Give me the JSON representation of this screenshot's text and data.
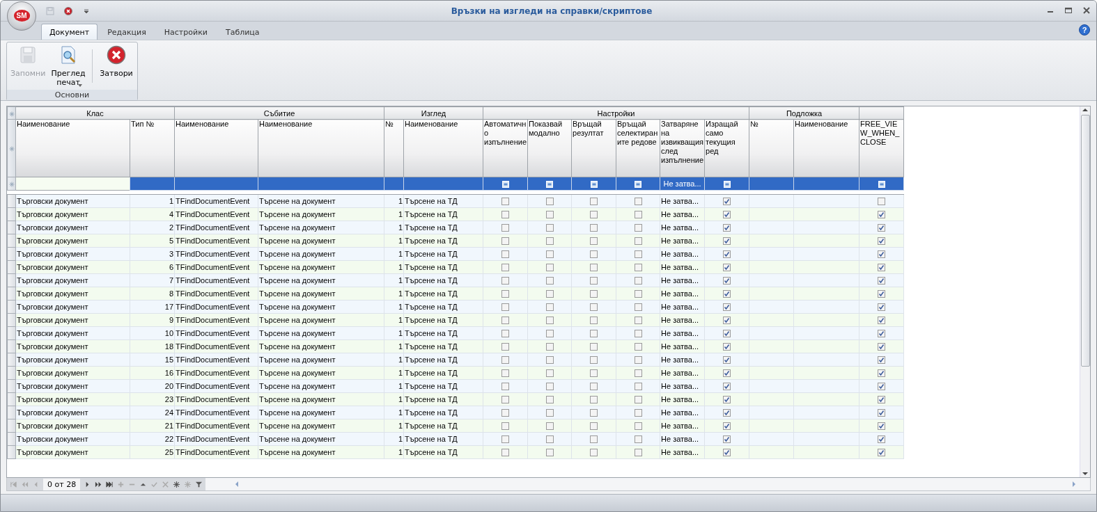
{
  "window": {
    "title": "Връзки на изгледи на справки/скриптове",
    "logo": "SM",
    "help": "?"
  },
  "ribbon_tabs": [
    {
      "label": "Документ",
      "selected": true
    },
    {
      "label": "Редакция",
      "selected": false
    },
    {
      "label": "Настройки",
      "selected": false
    },
    {
      "label": "Таблица",
      "selected": false
    }
  ],
  "ribbon_group": {
    "label": "Основни",
    "buttons": [
      {
        "kind": "save",
        "label": "Запомни",
        "disabled": true,
        "dropdown": false
      },
      {
        "kind": "preview",
        "label": "Преглед печат",
        "disabled": false,
        "dropdown": true
      },
      {
        "kind": "close",
        "label": "Затвори",
        "disabled": false,
        "dropdown": false
      }
    ]
  },
  "grid": {
    "bands": [
      {
        "label": "Клас"
      },
      {
        "label": "Събитие"
      },
      {
        "label": "Изглед"
      },
      {
        "label": "Настройки"
      },
      {
        "label": "Подложка"
      }
    ],
    "columns": [
      {
        "label": "Наименование",
        "kind": "text"
      },
      {
        "label": "Тип №",
        "kind": "number"
      },
      {
        "label": "Наименование",
        "kind": "text"
      },
      {
        "label": "Наименование",
        "kind": "text"
      },
      {
        "label": "№",
        "kind": "number"
      },
      {
        "label": "Наименование",
        "kind": "text"
      },
      {
        "label": "Автоматично изпълнение",
        "kind": "check"
      },
      {
        "label": "Показвай модално",
        "kind": "check"
      },
      {
        "label": "Връщай резултат",
        "kind": "check"
      },
      {
        "label": "Връщай селектираните редове",
        "kind": "check"
      },
      {
        "label": "Затваряне на извикващия след изпълнение",
        "kind": "text"
      },
      {
        "label": "Изращай само текущия ред",
        "kind": "check"
      },
      {
        "label": "№",
        "kind": "text"
      },
      {
        "label": "Наименование",
        "kind": "text"
      },
      {
        "label": "FREE_VIEW_WHEN_CLOSE",
        "kind": "check"
      }
    ],
    "filter_row": {
      "selected": true,
      "cells": [
        null,
        null,
        null,
        null,
        null,
        null,
        null,
        null,
        null,
        null,
        "Не затва...",
        null,
        null,
        null,
        null
      ]
    },
    "rows": [
      {
        "cells": [
          "Търговски документ",
          "1",
          "TFindDocumentEvent",
          "Търсене на документ",
          "1",
          "Търсене на ТД",
          false,
          false,
          false,
          false,
          "Не затва...",
          true,
          null,
          null,
          false
        ]
      },
      {
        "cells": [
          "Търговски документ",
          "4",
          "TFindDocumentEvent",
          "Търсене на документ",
          "1",
          "Търсене на ТД",
          false,
          false,
          false,
          false,
          "Не затва...",
          true,
          null,
          null,
          true
        ]
      },
      {
        "cells": [
          "Търговски документ",
          "2",
          "TFindDocumentEvent",
          "Търсене на документ",
          "1",
          "Търсене на ТД",
          false,
          false,
          false,
          false,
          "Не затва...",
          true,
          null,
          null,
          true
        ]
      },
      {
        "cells": [
          "Търговски документ",
          "5",
          "TFindDocumentEvent",
          "Търсене на документ",
          "1",
          "Търсене на ТД",
          false,
          false,
          false,
          false,
          "Не затва...",
          true,
          null,
          null,
          true
        ]
      },
      {
        "cells": [
          "Търговски документ",
          "3",
          "TFindDocumentEvent",
          "Търсене на документ",
          "1",
          "Търсене на ТД",
          false,
          false,
          false,
          false,
          "Не затва...",
          true,
          null,
          null,
          true
        ]
      },
      {
        "cells": [
          "Търговски документ",
          "6",
          "TFindDocumentEvent",
          "Търсене на документ",
          "1",
          "Търсене на ТД",
          false,
          false,
          false,
          false,
          "Не затва...",
          true,
          null,
          null,
          true
        ]
      },
      {
        "cells": [
          "Търговски документ",
          "7",
          "TFindDocumentEvent",
          "Търсене на документ",
          "1",
          "Търсене на ТД",
          false,
          false,
          false,
          false,
          "Не затва...",
          true,
          null,
          null,
          true
        ]
      },
      {
        "cells": [
          "Търговски документ",
          "8",
          "TFindDocumentEvent",
          "Търсене на документ",
          "1",
          "Търсене на ТД",
          false,
          false,
          false,
          false,
          "Не затва...",
          true,
          null,
          null,
          true
        ]
      },
      {
        "cells": [
          "Търговски документ",
          "17",
          "TFindDocumentEvent",
          "Търсене на документ",
          "1",
          "Търсене на ТД",
          false,
          false,
          false,
          false,
          "Не затва...",
          true,
          null,
          null,
          true
        ]
      },
      {
        "cells": [
          "Търговски документ",
          "9",
          "TFindDocumentEvent",
          "Търсене на документ",
          "1",
          "Търсене на ТД",
          false,
          false,
          false,
          false,
          "Не затва...",
          true,
          null,
          null,
          true
        ]
      },
      {
        "cells": [
          "Търговски документ",
          "10",
          "TFindDocumentEvent",
          "Търсене на документ",
          "1",
          "Търсене на ТД",
          false,
          false,
          false,
          false,
          "Не затва...",
          true,
          null,
          null,
          true
        ]
      },
      {
        "cells": [
          "Търговски документ",
          "18",
          "TFindDocumentEvent",
          "Търсене на документ",
          "1",
          "Търсене на ТД",
          false,
          false,
          false,
          false,
          "Не затва...",
          true,
          null,
          null,
          true
        ]
      },
      {
        "cells": [
          "Търговски документ",
          "15",
          "TFindDocumentEvent",
          "Търсене на документ",
          "1",
          "Търсене на ТД",
          false,
          false,
          false,
          false,
          "Не затва...",
          true,
          null,
          null,
          true
        ]
      },
      {
        "cells": [
          "Търговски документ",
          "16",
          "TFindDocumentEvent",
          "Търсене на документ",
          "1",
          "Търсене на ТД",
          false,
          false,
          false,
          false,
          "Не затва...",
          true,
          null,
          null,
          true
        ]
      },
      {
        "cells": [
          "Търговски документ",
          "20",
          "TFindDocumentEvent",
          "Търсене на документ",
          "1",
          "Търсене на ТД",
          false,
          false,
          false,
          false,
          "Не затва...",
          true,
          null,
          null,
          true
        ]
      },
      {
        "cells": [
          "Търговски документ",
          "23",
          "TFindDocumentEvent",
          "Търсене на документ",
          "1",
          "Търсене на ТД",
          false,
          false,
          false,
          false,
          "Не затва...",
          true,
          null,
          null,
          true
        ]
      },
      {
        "cells": [
          "Търговски документ",
          "24",
          "TFindDocumentEvent",
          "Търсене на документ",
          "1",
          "Търсене на ТД",
          false,
          false,
          false,
          false,
          "Не затва...",
          true,
          null,
          null,
          true
        ]
      },
      {
        "cells": [
          "Търговски документ",
          "21",
          "TFindDocumentEvent",
          "Търсене на документ",
          "1",
          "Търсене на ТД",
          false,
          false,
          false,
          false,
          "Не затва...",
          true,
          null,
          null,
          true
        ]
      },
      {
        "cells": [
          "Търговски документ",
          "22",
          "TFindDocumentEvent",
          "Търсене на документ",
          "1",
          "Търсене на ТД",
          false,
          false,
          false,
          false,
          "Не затва...",
          true,
          null,
          null,
          true
        ]
      },
      {
        "cells": [
          "Търговски документ",
          "25",
          "TFindDocumentEvent",
          "Търсене на документ",
          "1",
          "Търсене на ТД",
          false,
          false,
          false,
          false,
          "Не затва...",
          true,
          null,
          null,
          true
        ]
      }
    ]
  },
  "navigator": {
    "record": "0 от 28"
  }
}
